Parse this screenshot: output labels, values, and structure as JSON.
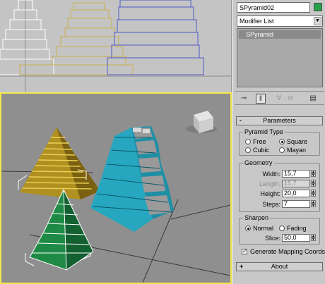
{
  "object_name": "SPyramid02",
  "object_color": "#27a04a",
  "modifier_list_label": "Modifier List",
  "modifier_stack": [
    "SPyramid"
  ],
  "toolbar_icons": [
    "pin-stack-icon",
    "show-end-result-icon",
    "make-unique-icon",
    "remove-modifier-icon",
    "configure-modifier-sets-icon"
  ],
  "parameters": {
    "header": "Parameters",
    "collapse_sign": "-",
    "pyramid_type": {
      "title": "Pyramid Type",
      "options": [
        "Free",
        "Square",
        "Cubic",
        "Mayan"
      ],
      "selected": "Square"
    },
    "geometry": {
      "title": "Geometry",
      "width_label": "Width:",
      "width_value": "15,7",
      "length_label": "Length:",
      "length_value": "15,7",
      "height_label": "Height:",
      "height_value": "20,0",
      "steps_label": "Steps:",
      "steps_value": "7"
    },
    "sharpen": {
      "title": "Sharpen",
      "options": [
        "Normal",
        "Fading"
      ],
      "selected": "Normal",
      "slice_label": "Slice:",
      "slice_value": "50,0"
    },
    "generate_mapping_label": "Generate Mapping Coords.",
    "generate_mapping_checked": true
  },
  "about": {
    "header": "About",
    "expand_sign": "+"
  }
}
